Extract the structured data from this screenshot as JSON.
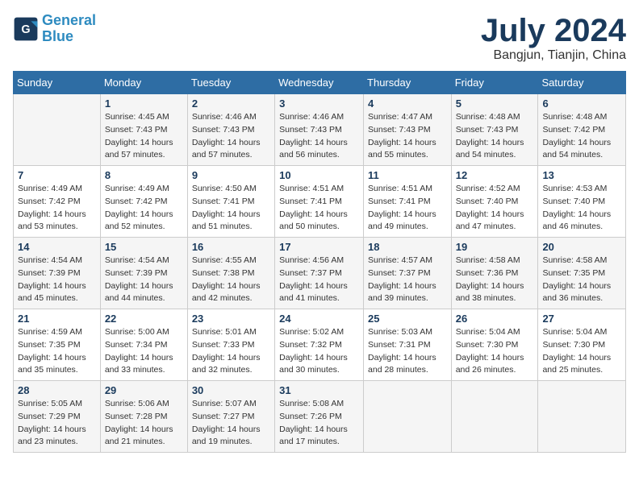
{
  "header": {
    "logo_line1": "General",
    "logo_line2": "Blue",
    "month_title": "July 2024",
    "location": "Bangjun, Tianjin, China"
  },
  "weekdays": [
    "Sunday",
    "Monday",
    "Tuesday",
    "Wednesday",
    "Thursday",
    "Friday",
    "Saturday"
  ],
  "weeks": [
    [
      {
        "day": "",
        "sunrise": "",
        "sunset": "",
        "daylight": ""
      },
      {
        "day": "1",
        "sunrise": "Sunrise: 4:45 AM",
        "sunset": "Sunset: 7:43 PM",
        "daylight": "Daylight: 14 hours and 57 minutes."
      },
      {
        "day": "2",
        "sunrise": "Sunrise: 4:46 AM",
        "sunset": "Sunset: 7:43 PM",
        "daylight": "Daylight: 14 hours and 57 minutes."
      },
      {
        "day": "3",
        "sunrise": "Sunrise: 4:46 AM",
        "sunset": "Sunset: 7:43 PM",
        "daylight": "Daylight: 14 hours and 56 minutes."
      },
      {
        "day": "4",
        "sunrise": "Sunrise: 4:47 AM",
        "sunset": "Sunset: 7:43 PM",
        "daylight": "Daylight: 14 hours and 55 minutes."
      },
      {
        "day": "5",
        "sunrise": "Sunrise: 4:48 AM",
        "sunset": "Sunset: 7:43 PM",
        "daylight": "Daylight: 14 hours and 54 minutes."
      },
      {
        "day": "6",
        "sunrise": "Sunrise: 4:48 AM",
        "sunset": "Sunset: 7:42 PM",
        "daylight": "Daylight: 14 hours and 54 minutes."
      }
    ],
    [
      {
        "day": "7",
        "sunrise": "Sunrise: 4:49 AM",
        "sunset": "Sunset: 7:42 PM",
        "daylight": "Daylight: 14 hours and 53 minutes."
      },
      {
        "day": "8",
        "sunrise": "Sunrise: 4:49 AM",
        "sunset": "Sunset: 7:42 PM",
        "daylight": "Daylight: 14 hours and 52 minutes."
      },
      {
        "day": "9",
        "sunrise": "Sunrise: 4:50 AM",
        "sunset": "Sunset: 7:41 PM",
        "daylight": "Daylight: 14 hours and 51 minutes."
      },
      {
        "day": "10",
        "sunrise": "Sunrise: 4:51 AM",
        "sunset": "Sunset: 7:41 PM",
        "daylight": "Daylight: 14 hours and 50 minutes."
      },
      {
        "day": "11",
        "sunrise": "Sunrise: 4:51 AM",
        "sunset": "Sunset: 7:41 PM",
        "daylight": "Daylight: 14 hours and 49 minutes."
      },
      {
        "day": "12",
        "sunrise": "Sunrise: 4:52 AM",
        "sunset": "Sunset: 7:40 PM",
        "daylight": "Daylight: 14 hours and 47 minutes."
      },
      {
        "day": "13",
        "sunrise": "Sunrise: 4:53 AM",
        "sunset": "Sunset: 7:40 PM",
        "daylight": "Daylight: 14 hours and 46 minutes."
      }
    ],
    [
      {
        "day": "14",
        "sunrise": "Sunrise: 4:54 AM",
        "sunset": "Sunset: 7:39 PM",
        "daylight": "Daylight: 14 hours and 45 minutes."
      },
      {
        "day": "15",
        "sunrise": "Sunrise: 4:54 AM",
        "sunset": "Sunset: 7:39 PM",
        "daylight": "Daylight: 14 hours and 44 minutes."
      },
      {
        "day": "16",
        "sunrise": "Sunrise: 4:55 AM",
        "sunset": "Sunset: 7:38 PM",
        "daylight": "Daylight: 14 hours and 42 minutes."
      },
      {
        "day": "17",
        "sunrise": "Sunrise: 4:56 AM",
        "sunset": "Sunset: 7:37 PM",
        "daylight": "Daylight: 14 hours and 41 minutes."
      },
      {
        "day": "18",
        "sunrise": "Sunrise: 4:57 AM",
        "sunset": "Sunset: 7:37 PM",
        "daylight": "Daylight: 14 hours and 39 minutes."
      },
      {
        "day": "19",
        "sunrise": "Sunrise: 4:58 AM",
        "sunset": "Sunset: 7:36 PM",
        "daylight": "Daylight: 14 hours and 38 minutes."
      },
      {
        "day": "20",
        "sunrise": "Sunrise: 4:58 AM",
        "sunset": "Sunset: 7:35 PM",
        "daylight": "Daylight: 14 hours and 36 minutes."
      }
    ],
    [
      {
        "day": "21",
        "sunrise": "Sunrise: 4:59 AM",
        "sunset": "Sunset: 7:35 PM",
        "daylight": "Daylight: 14 hours and 35 minutes."
      },
      {
        "day": "22",
        "sunrise": "Sunrise: 5:00 AM",
        "sunset": "Sunset: 7:34 PM",
        "daylight": "Daylight: 14 hours and 33 minutes."
      },
      {
        "day": "23",
        "sunrise": "Sunrise: 5:01 AM",
        "sunset": "Sunset: 7:33 PM",
        "daylight": "Daylight: 14 hours and 32 minutes."
      },
      {
        "day": "24",
        "sunrise": "Sunrise: 5:02 AM",
        "sunset": "Sunset: 7:32 PM",
        "daylight": "Daylight: 14 hours and 30 minutes."
      },
      {
        "day": "25",
        "sunrise": "Sunrise: 5:03 AM",
        "sunset": "Sunset: 7:31 PM",
        "daylight": "Daylight: 14 hours and 28 minutes."
      },
      {
        "day": "26",
        "sunrise": "Sunrise: 5:04 AM",
        "sunset": "Sunset: 7:30 PM",
        "daylight": "Daylight: 14 hours and 26 minutes."
      },
      {
        "day": "27",
        "sunrise": "Sunrise: 5:04 AM",
        "sunset": "Sunset: 7:30 PM",
        "daylight": "Daylight: 14 hours and 25 minutes."
      }
    ],
    [
      {
        "day": "28",
        "sunrise": "Sunrise: 5:05 AM",
        "sunset": "Sunset: 7:29 PM",
        "daylight": "Daylight: 14 hours and 23 minutes."
      },
      {
        "day": "29",
        "sunrise": "Sunrise: 5:06 AM",
        "sunset": "Sunset: 7:28 PM",
        "daylight": "Daylight: 14 hours and 21 minutes."
      },
      {
        "day": "30",
        "sunrise": "Sunrise: 5:07 AM",
        "sunset": "Sunset: 7:27 PM",
        "daylight": "Daylight: 14 hours and 19 minutes."
      },
      {
        "day": "31",
        "sunrise": "Sunrise: 5:08 AM",
        "sunset": "Sunset: 7:26 PM",
        "daylight": "Daylight: 14 hours and 17 minutes."
      },
      {
        "day": "",
        "sunrise": "",
        "sunset": "",
        "daylight": ""
      },
      {
        "day": "",
        "sunrise": "",
        "sunset": "",
        "daylight": ""
      },
      {
        "day": "",
        "sunrise": "",
        "sunset": "",
        "daylight": ""
      }
    ]
  ]
}
